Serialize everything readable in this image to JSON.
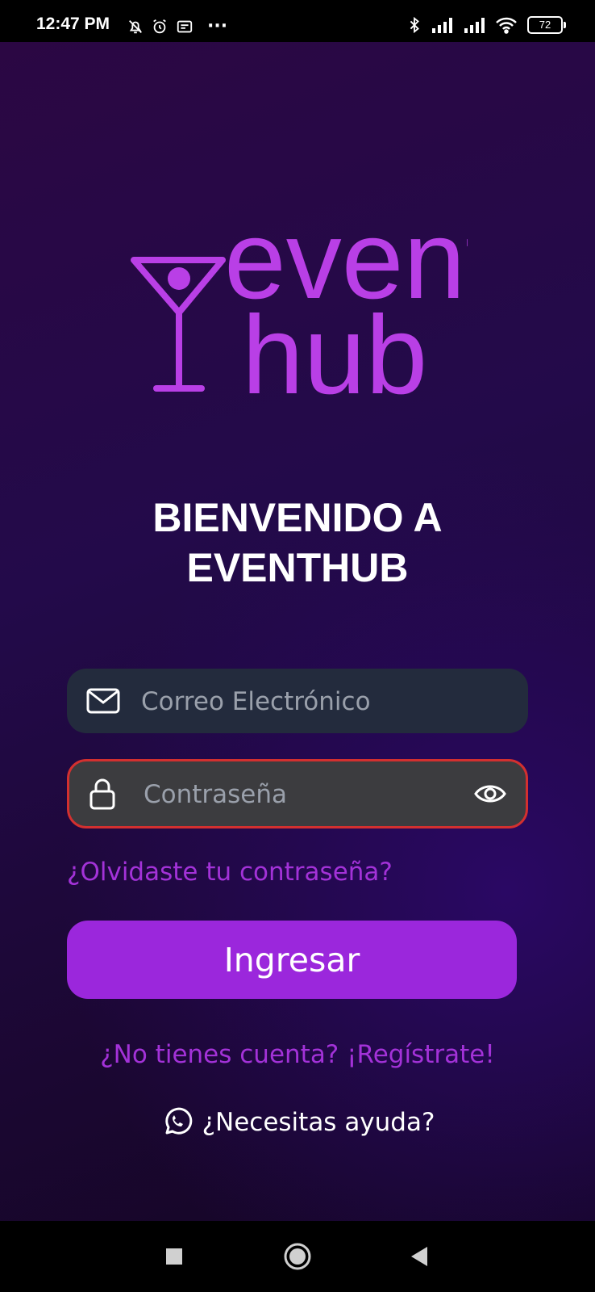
{
  "status_bar": {
    "time": "12:47 PM",
    "more": "···",
    "battery": "72"
  },
  "logo": {
    "line1": "event",
    "line2": "hub",
    "color": "#b93fe6"
  },
  "welcome": {
    "line1": "BIENVENIDO A",
    "line2": "EVENTHUB"
  },
  "email": {
    "placeholder": "Correo Electrónico",
    "value": ""
  },
  "password": {
    "placeholder": "Contraseña",
    "value": ""
  },
  "forgot_label": "¿Olvidaste tu contraseña?",
  "login_label": "Ingresar",
  "register_label": "¿No tienes cuenta? ¡Regístrate!",
  "help_label": "¿Necesitas ayuda?",
  "colors": {
    "accent": "#9b27dc",
    "link": "#a332d8",
    "error_border": "#d3302f"
  }
}
